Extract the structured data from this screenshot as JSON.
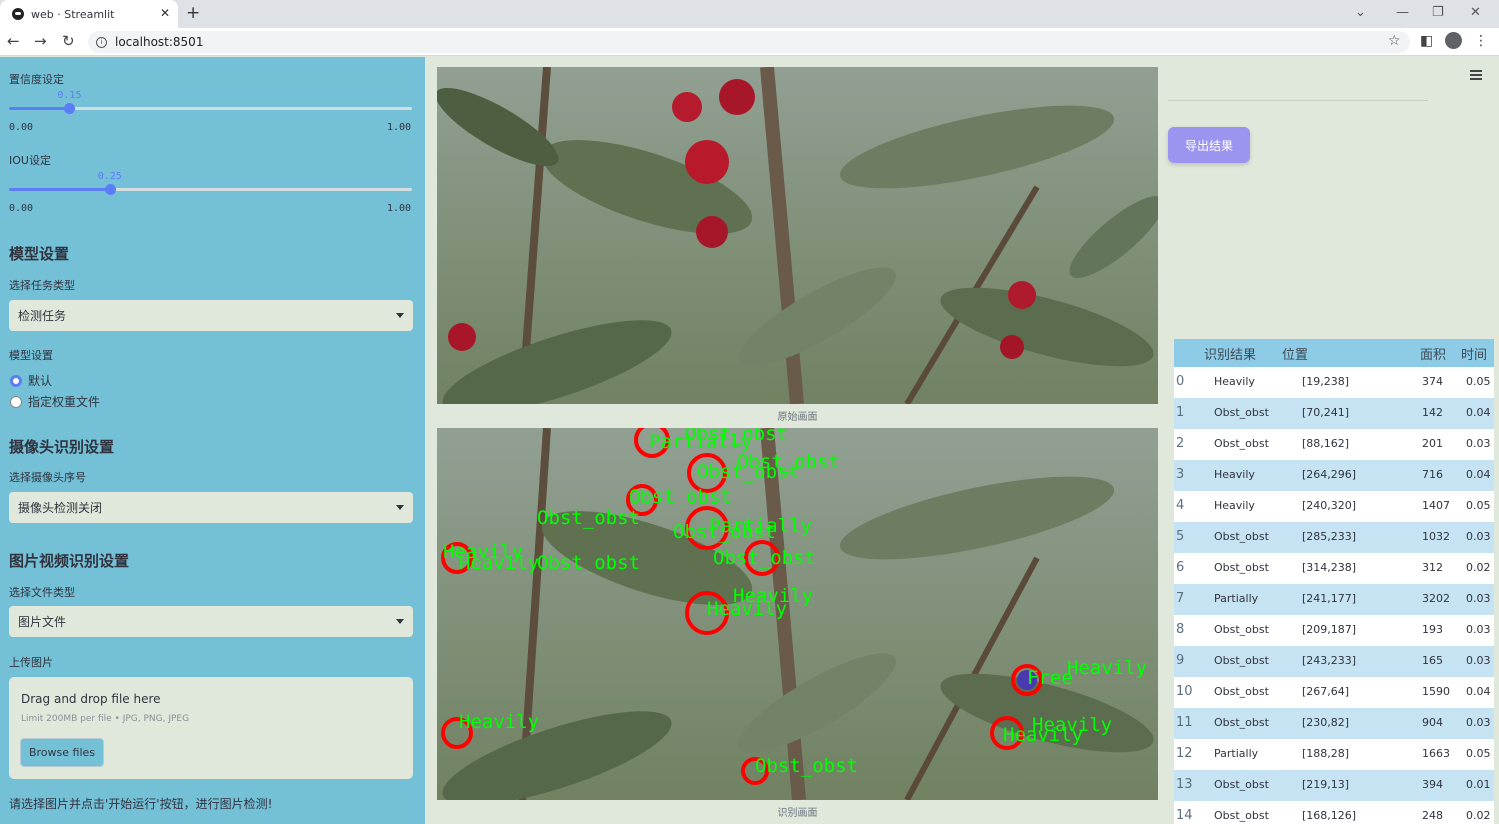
{
  "browser": {
    "tab_title": "web · Streamlit",
    "url": "localhost:8501"
  },
  "sidebar": {
    "confidence": {
      "label": "置信度设定",
      "value": "0.15",
      "value_num": 0.15,
      "min": "0.00",
      "max": "1.00"
    },
    "iou": {
      "label": "IOU设定",
      "value": "0.25",
      "value_num": 0.25,
      "min": "0.00",
      "max": "1.00"
    },
    "model_section_title": "模型设置",
    "task_type_label": "选择任务类型",
    "task_type_value": "检测任务",
    "model_setting_label": "模型设置",
    "model_options": [
      "默认",
      "指定权重文件"
    ],
    "camera_section_title": "摄像头识别设置",
    "camera_label": "选择摄像头序号",
    "camera_value": "摄像头检测关闭",
    "media_section_title": "图片视频识别设置",
    "file_type_label": "选择文件类型",
    "file_type_value": "图片文件",
    "upload_label": "上传图片",
    "upload_drag_text": "Drag and drop file here",
    "upload_limit_text": "Limit 200MB per file • JPG, PNG, JPEG",
    "browse_button": "Browse files",
    "footer_hint": "请选择图片并点击'开始运行'按钮，进行图片检测!"
  },
  "main": {
    "original_caption": "原始画面",
    "result_caption": "识别画面",
    "export_button": "导出结果",
    "detection_labels": [
      {
        "text": "Obst_obst"
      },
      {
        "text": "Partially"
      },
      {
        "text": "Obst_obst"
      },
      {
        "text": "Obst_obst"
      },
      {
        "text": "Obst_obst"
      },
      {
        "text": "Obst_obst"
      },
      {
        "text": "Partially"
      },
      {
        "text": "Obst_obst"
      },
      {
        "text": "Heavily"
      },
      {
        "text": "Heavily"
      },
      {
        "text": "Obst_obst"
      },
      {
        "text": "Obst_obst"
      },
      {
        "text": "Heavily"
      },
      {
        "text": "Heavily"
      },
      {
        "text": "Heavily"
      },
      {
        "text": "Free"
      },
      {
        "text": "Heavily"
      },
      {
        "text": "Heavily"
      },
      {
        "text": "Heavily"
      },
      {
        "text": "Obst_obst"
      }
    ]
  },
  "table": {
    "headers": [
      "识别结果",
      "位置",
      "面积",
      "时间"
    ],
    "rows": [
      {
        "idx": "0",
        "result": "Heavily",
        "pos": "[19,238]",
        "area": "374",
        "time": "0.05"
      },
      {
        "idx": "1",
        "result": "Obst_obst",
        "pos": "[70,241]",
        "area": "142",
        "time": "0.04"
      },
      {
        "idx": "2",
        "result": "Obst_obst",
        "pos": "[88,162]",
        "area": "201",
        "time": "0.03"
      },
      {
        "idx": "3",
        "result": "Heavily",
        "pos": "[264,296]",
        "area": "716",
        "time": "0.04"
      },
      {
        "idx": "4",
        "result": "Heavily",
        "pos": "[240,320]",
        "area": "1407",
        "time": "0.05"
      },
      {
        "idx": "5",
        "result": "Obst_obst",
        "pos": "[285,233]",
        "area": "1032",
        "time": "0.03"
      },
      {
        "idx": "6",
        "result": "Obst_obst",
        "pos": "[314,238]",
        "area": "312",
        "time": "0.02"
      },
      {
        "idx": "7",
        "result": "Partially",
        "pos": "[241,177]",
        "area": "3202",
        "time": "0.03"
      },
      {
        "idx": "8",
        "result": "Obst_obst",
        "pos": "[209,187]",
        "area": "193",
        "time": "0.03"
      },
      {
        "idx": "9",
        "result": "Obst_obst",
        "pos": "[243,233]",
        "area": "165",
        "time": "0.03"
      },
      {
        "idx": "10",
        "result": "Obst_obst",
        "pos": "[267,64]",
        "area": "1590",
        "time": "0.04"
      },
      {
        "idx": "11",
        "result": "Obst_obst",
        "pos": "[230,82]",
        "area": "904",
        "time": "0.03"
      },
      {
        "idx": "12",
        "result": "Partially",
        "pos": "[188,28]",
        "area": "1663",
        "time": "0.05"
      },
      {
        "idx": "13",
        "result": "Obst_obst",
        "pos": "[219,13]",
        "area": "394",
        "time": "0.01"
      },
      {
        "idx": "14",
        "result": "Obst_obst",
        "pos": "[168,126]",
        "area": "248",
        "time": "0.02"
      }
    ]
  },
  "colors": {
    "sidebar_bg": "#74c1d7",
    "accent": "#5b7df5",
    "export_button": "#9b95f0",
    "table_header": "#8ecbe6",
    "detection_box": "#ff0000",
    "detection_text": "#00ff00"
  }
}
